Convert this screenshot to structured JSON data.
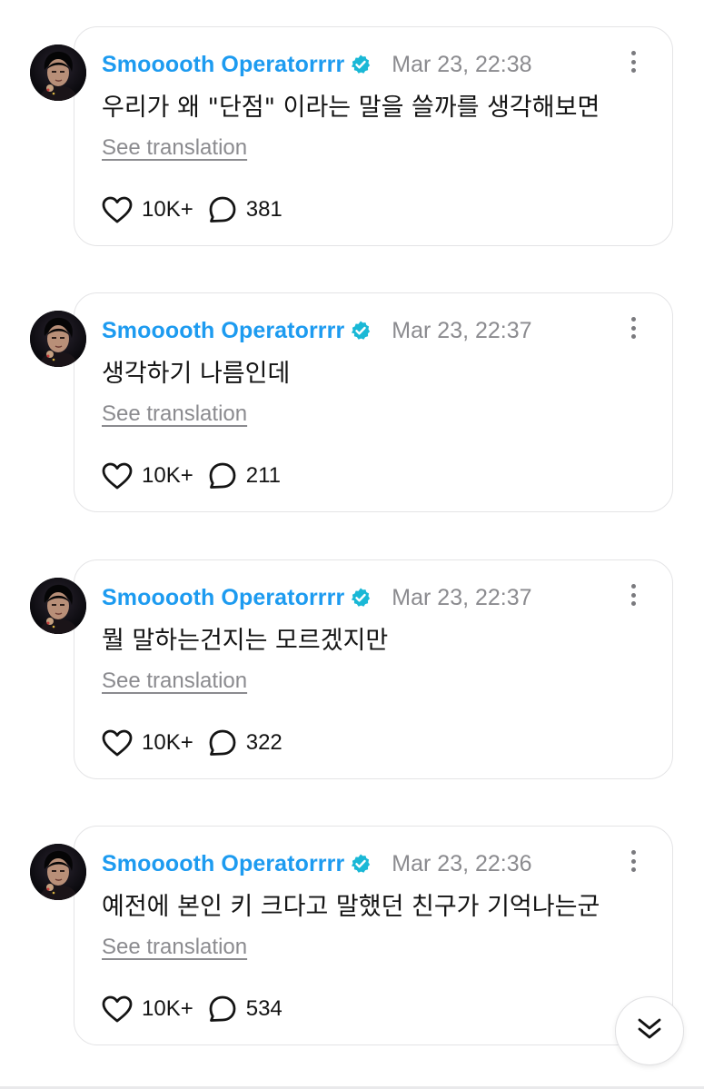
{
  "colors": {
    "username": "#1d9bf0",
    "verified_badge": "#1ab8d6",
    "timestamp": "#8b8b8f",
    "text": "#141414",
    "border": "#e4e4e6"
  },
  "posts": [
    {
      "username": "Smooooth Operatorrrr",
      "verified": true,
      "timestamp": "Mar 23, 22:38",
      "text": "우리가 왜 \"단점\" 이라는 말을 쓸까를 생각해보면",
      "translate_label": "See translation",
      "likes": "10K+",
      "replies": "381"
    },
    {
      "username": "Smooooth Operatorrrr",
      "verified": true,
      "timestamp": "Mar 23, 22:37",
      "text": "생각하기 나름인데",
      "translate_label": "See translation",
      "likes": "10K+",
      "replies": "211"
    },
    {
      "username": "Smooooth Operatorrrr",
      "verified": true,
      "timestamp": "Mar 23, 22:37",
      "text": "뭘 말하는건지는 모르겠지만",
      "translate_label": "See translation",
      "likes": "10K+",
      "replies": "322"
    },
    {
      "username": "Smooooth Operatorrrr",
      "verified": true,
      "timestamp": "Mar 23, 22:36",
      "text": "예전에 본인 키 크다고 말했던 친구가 기억나는군",
      "translate_label": "See translation",
      "likes": "10K+",
      "replies": "534"
    }
  ],
  "icons": {
    "avatar": "avatar",
    "verified": "verified-badge-icon",
    "more": "more-options-icon",
    "like": "heart-icon",
    "reply": "speech-bubble-icon",
    "scroll": "double-chevron-down-icon"
  }
}
